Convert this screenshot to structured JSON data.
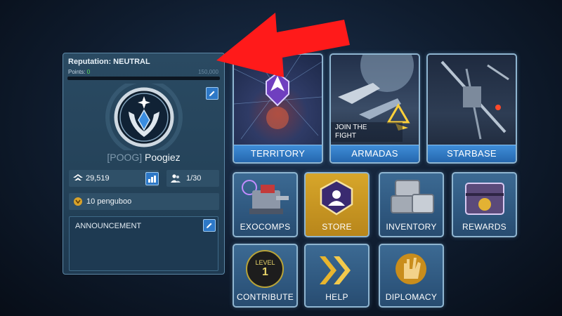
{
  "reputation": {
    "title": "Reputation: NEUTRAL",
    "points_label": "Points:",
    "points_value": "0",
    "points_max": "150,000",
    "progress": 0
  },
  "profile": {
    "tag": "[POOG]",
    "name": "Poogiez",
    "power": "29,519",
    "members": "1/30",
    "leader": "10  penguboo"
  },
  "announcement": {
    "label": "ANNOUNCEMENT"
  },
  "tiles": {
    "territory": "TERRITORY",
    "armadas": "ARMADAS",
    "armadas_banner": "JOIN THE\nFIGHT",
    "starbase": "STARBASE",
    "exocomps": "EXOCOMPS",
    "store": "STORE",
    "inventory": "INVENTORY",
    "rewards": "REWARDS",
    "contribute": "CONTRIBUTE",
    "contribute_level_word": "LEVEL",
    "contribute_level_num": "1",
    "help": "HELP",
    "diplomacy": "DIPLOMACY"
  },
  "colors": {
    "accent_blue": "#2d78c7",
    "points_green": "#5be35b",
    "annotation_arrow": "#ff1a1a",
    "store_gold": "#e8b52e"
  }
}
